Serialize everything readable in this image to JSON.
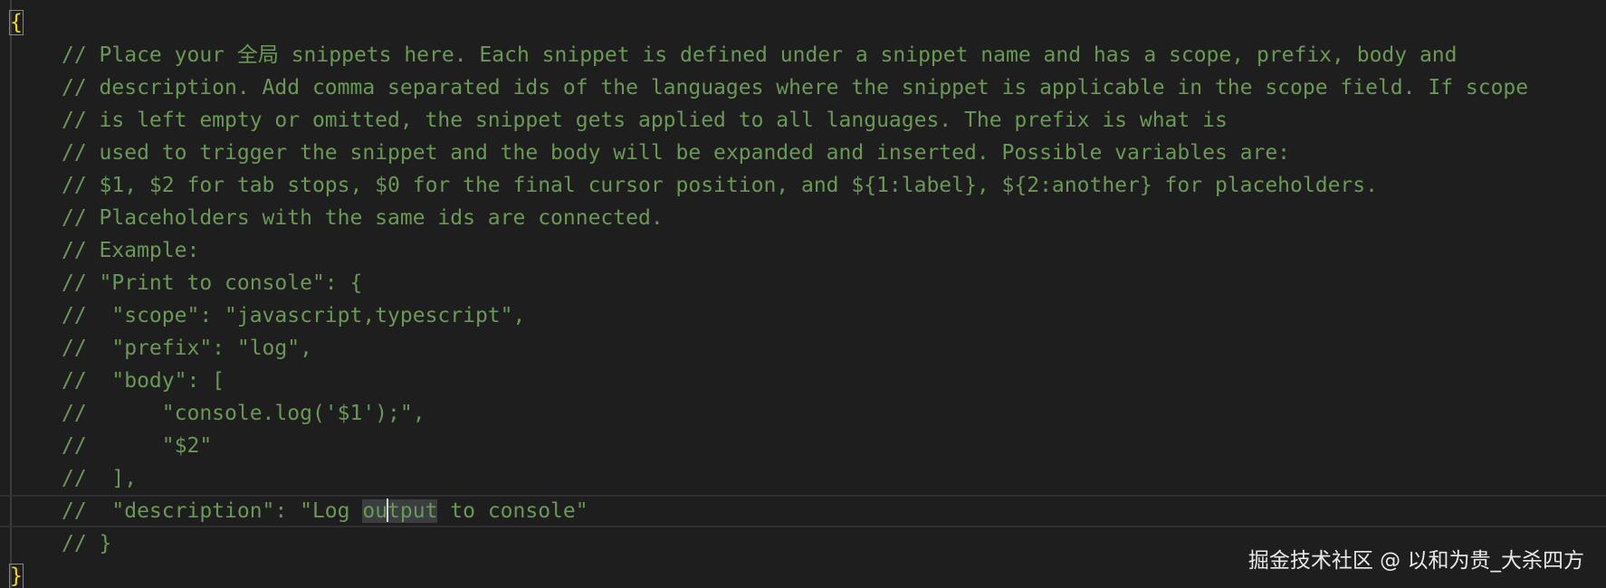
{
  "editor": {
    "open_brace": "{",
    "close_brace": "}",
    "lines": [
      "// Place your 全局 snippets here. Each snippet is defined under a snippet name and has a scope, prefix, body and",
      "// description. Add comma separated ids of the languages where the snippet is applicable in the scope field. If scope",
      "// is left empty or omitted, the snippet gets applied to all languages. The prefix is what is",
      "// used to trigger the snippet and the body will be expanded and inserted. Possible variables are:",
      "// $1, $2 for tab stops, $0 for the final cursor position, and ${1:label}, ${2:another} for placeholders.",
      "// Placeholders with the same ids are connected.",
      "// Example:",
      "// \"Print to console\": {",
      "//  \"scope\": \"javascript,typescript\",",
      "//  \"prefix\": \"log\",",
      "//  \"body\": [",
      "//      \"console.log('$1');\",",
      "//      \"$2\"",
      "//  ],"
    ],
    "current_line": {
      "before": "//  \"description\": \"Log ",
      "selected_a": "ou",
      "selected_b": "tput",
      "after": " to console\""
    },
    "last_line": "// }"
  },
  "watermark": "掘金技术社区 @ 以和为贵_大杀四方",
  "colors": {
    "background": "#1e1e1e",
    "comment": "#6a9955",
    "brace": "#ffd700",
    "selection": "#3a3d41"
  }
}
